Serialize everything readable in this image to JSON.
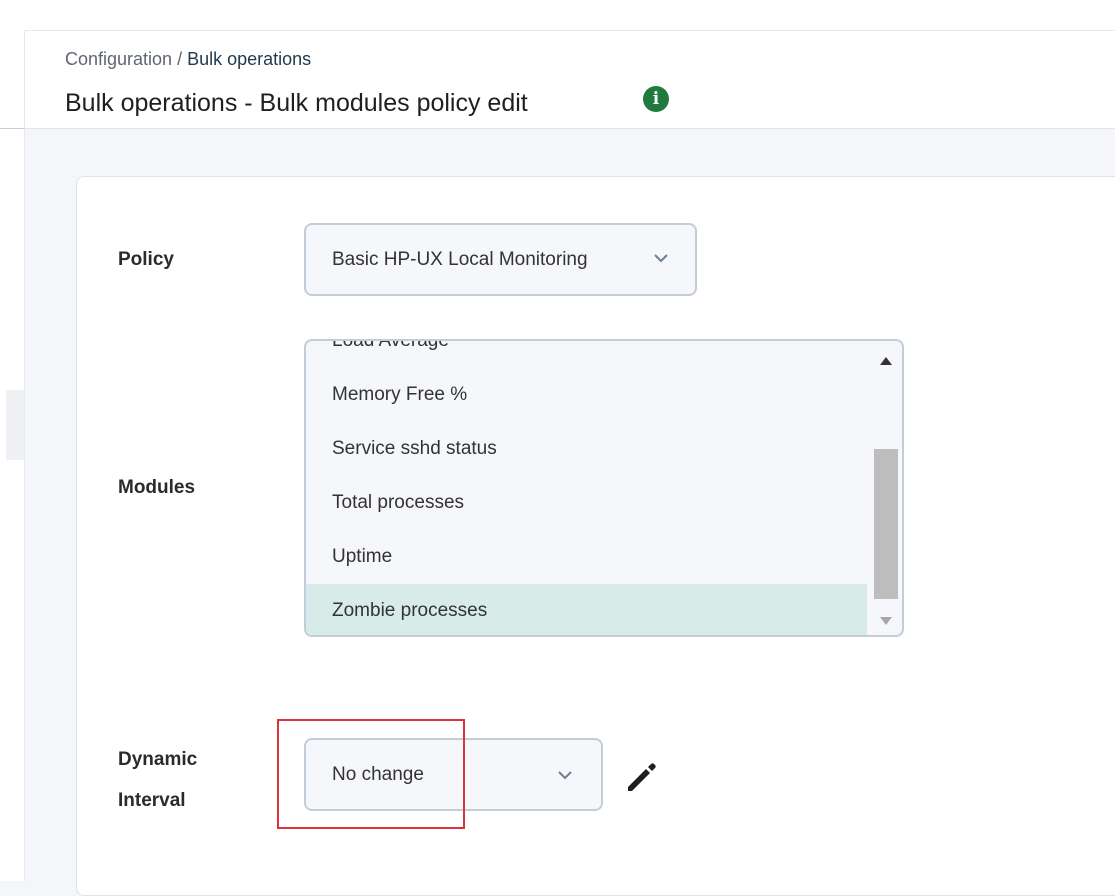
{
  "breadcrumb": {
    "parent": "Configuration",
    "separator": " / ",
    "current": "Bulk operations"
  },
  "header": {
    "title": "Bulk operations - Bulk modules policy edit",
    "info_icon": "info-icon",
    "info_icon_glyph": "i"
  },
  "form": {
    "policy": {
      "label": "Policy",
      "selected": "Basic HP-UX Local Monitoring"
    },
    "modules": {
      "label": "Modules",
      "items": [
        "Load Average",
        "Memory Free %",
        "Service sshd status",
        "Total processes",
        "Uptime",
        "Zombie processes"
      ],
      "selected": "Zombie processes"
    },
    "dynamic_interval": {
      "label": "Dynamic Interval",
      "selected": "No change",
      "edit_icon": "pencil-icon"
    }
  },
  "colors": {
    "accent_green": "#1f7a3e",
    "selected_row": "#d7ece9",
    "highlight_red": "#e0303a"
  }
}
